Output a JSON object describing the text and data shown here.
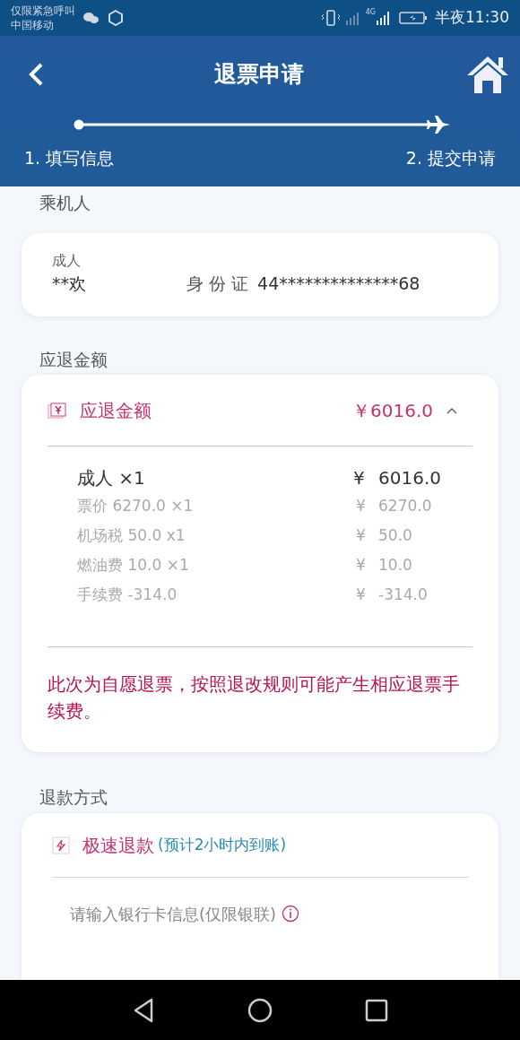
{
  "status_bar": {
    "notice": "仅限紧急呼叫",
    "carrier": "中国移动",
    "network": "4G",
    "time": "半夜11:30"
  },
  "header": {
    "title": "退票申请",
    "steps": [
      {
        "label": "1. 填写信息"
      },
      {
        "label": "2. 提交申请"
      }
    ]
  },
  "passenger_section": {
    "title": "乘机人",
    "type": "成人",
    "name": "**欢",
    "id_label": "身 份 证",
    "id_number": "44**************68"
  },
  "amount_section": {
    "title": "应退金额",
    "card_title": "应退金额",
    "total": "￥6016.0",
    "expanded": true,
    "summary": {
      "label": "成人 ×1",
      "currency": "¥",
      "amount": "6016.0"
    },
    "items": [
      {
        "label": "票价 6270.0 ×1",
        "currency": "¥",
        "amount": "6270.0"
      },
      {
        "label": "机场税 50.0 x1",
        "currency": "¥",
        "amount": "50.0"
      },
      {
        "label": "燃油费 10.0 ×1",
        "currency": "¥",
        "amount": "10.0"
      },
      {
        "label": "手续费 -314.0",
        "currency": "¥",
        "amount": "-314.0"
      }
    ],
    "notice": "此次为自愿退票，按照退改规则可能产生相应退票手续费。"
  },
  "refund_section": {
    "title": "退款方式",
    "method": "极速退款",
    "method_note": "(预计2小时内到账)",
    "bank_hint": "请输入银行卡信息(仅限银联)"
  }
}
